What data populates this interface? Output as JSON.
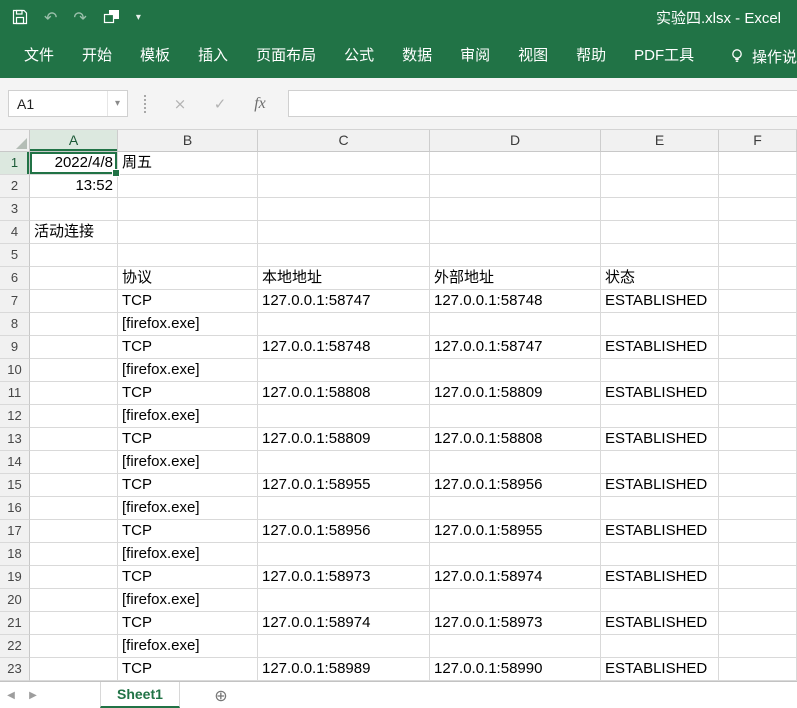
{
  "title_bar": {
    "document_title": "实验四.xlsx  -  Excel"
  },
  "ribbon": {
    "tabs": [
      "文件",
      "开始",
      "模板",
      "插入",
      "页面布局",
      "公式",
      "数据",
      "审阅",
      "视图",
      "帮助",
      "PDF工具"
    ],
    "tell_me_label": "操作说"
  },
  "formula_bar": {
    "name_box": "A1",
    "formula": ""
  },
  "icons": {
    "save": "floppy-disk",
    "undo": "↶",
    "redo": "↷",
    "touch_mode": "overlapping-squares",
    "qat_dropdown": "▾",
    "name_box_dropdown": "▾",
    "cancel": "×",
    "enter": "✓",
    "fx": "fx",
    "tell_me_bulb": "lightbulb",
    "prev_sheet": "◀",
    "next_sheet": "▶",
    "add_sheet": "⊕"
  },
  "grid": {
    "columns": [
      "A",
      "B",
      "C",
      "D",
      "E",
      "F"
    ],
    "selection": "A1",
    "rows": [
      {
        "n": 1,
        "cells": {
          "A": {
            "t": "2022/4/8",
            "align": "right"
          },
          "B": {
            "t": "周五"
          }
        }
      },
      {
        "n": 2,
        "cells": {
          "A": {
            "t": "13:52",
            "align": "right"
          }
        }
      },
      {
        "n": 3,
        "cells": {}
      },
      {
        "n": 4,
        "cells": {
          "A": {
            "t": "活动连接"
          }
        }
      },
      {
        "n": 5,
        "cells": {}
      },
      {
        "n": 6,
        "cells": {
          "B": {
            "t": "协议"
          },
          "C": {
            "t": "本地地址"
          },
          "D": {
            "t": "外部地址"
          },
          "E": {
            "t": "状态"
          }
        }
      },
      {
        "n": 7,
        "cells": {
          "B": {
            "t": "TCP"
          },
          "C": {
            "t": "127.0.0.1:58747"
          },
          "D": {
            "t": "127.0.0.1:58748"
          },
          "E": {
            "t": "ESTABLISHED"
          }
        }
      },
      {
        "n": 8,
        "cells": {
          "B": {
            "t": "[firefox.exe]"
          }
        }
      },
      {
        "n": 9,
        "cells": {
          "B": {
            "t": "TCP"
          },
          "C": {
            "t": "127.0.0.1:58748"
          },
          "D": {
            "t": "127.0.0.1:58747"
          },
          "E": {
            "t": "ESTABLISHED"
          }
        }
      },
      {
        "n": 10,
        "cells": {
          "B": {
            "t": "[firefox.exe]"
          }
        }
      },
      {
        "n": 11,
        "cells": {
          "B": {
            "t": "TCP"
          },
          "C": {
            "t": "127.0.0.1:58808"
          },
          "D": {
            "t": "127.0.0.1:58809"
          },
          "E": {
            "t": "ESTABLISHED"
          }
        }
      },
      {
        "n": 12,
        "cells": {
          "B": {
            "t": "[firefox.exe]"
          }
        }
      },
      {
        "n": 13,
        "cells": {
          "B": {
            "t": "TCP"
          },
          "C": {
            "t": "127.0.0.1:58809"
          },
          "D": {
            "t": "127.0.0.1:58808"
          },
          "E": {
            "t": "ESTABLISHED"
          }
        }
      },
      {
        "n": 14,
        "cells": {
          "B": {
            "t": "[firefox.exe]"
          }
        }
      },
      {
        "n": 15,
        "cells": {
          "B": {
            "t": "TCP"
          },
          "C": {
            "t": "127.0.0.1:58955"
          },
          "D": {
            "t": "127.0.0.1:58956"
          },
          "E": {
            "t": "ESTABLISHED"
          }
        }
      },
      {
        "n": 16,
        "cells": {
          "B": {
            "t": "[firefox.exe]"
          }
        }
      },
      {
        "n": 17,
        "cells": {
          "B": {
            "t": "TCP"
          },
          "C": {
            "t": "127.0.0.1:58956"
          },
          "D": {
            "t": "127.0.0.1:58955"
          },
          "E": {
            "t": "ESTABLISHED"
          }
        }
      },
      {
        "n": 18,
        "cells": {
          "B": {
            "t": "[firefox.exe]"
          }
        }
      },
      {
        "n": 19,
        "cells": {
          "B": {
            "t": "TCP"
          },
          "C": {
            "t": "127.0.0.1:58973"
          },
          "D": {
            "t": "127.0.0.1:58974"
          },
          "E": {
            "t": "ESTABLISHED"
          }
        }
      },
      {
        "n": 20,
        "cells": {
          "B": {
            "t": "[firefox.exe]"
          }
        }
      },
      {
        "n": 21,
        "cells": {
          "B": {
            "t": "TCP"
          },
          "C": {
            "t": "127.0.0.1:58974"
          },
          "D": {
            "t": "127.0.0.1:58973"
          },
          "E": {
            "t": "ESTABLISHED"
          }
        }
      },
      {
        "n": 22,
        "cells": {
          "B": {
            "t": "[firefox.exe]"
          }
        }
      },
      {
        "n": 23,
        "cells": {
          "B": {
            "t": "TCP"
          },
          "C": {
            "t": "127.0.0.1:58989"
          },
          "D": {
            "t": "127.0.0.1:58990"
          },
          "E": {
            "t": "ESTABLISHED"
          }
        }
      }
    ]
  },
  "sheet_bar": {
    "sheets": [
      "Sheet1"
    ],
    "active_sheet": "Sheet1"
  }
}
